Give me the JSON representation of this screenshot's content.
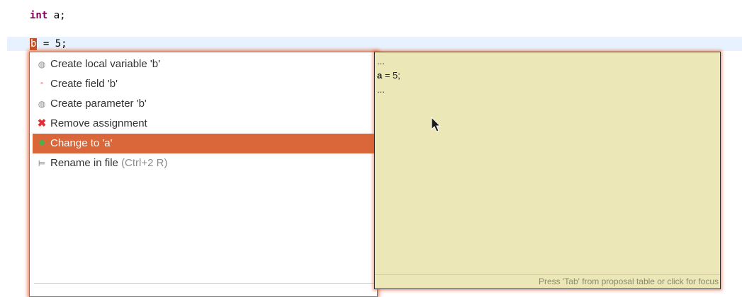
{
  "editor": {
    "line1": {
      "keyword": "int",
      "rest": " a;"
    },
    "line2": {
      "var": "b",
      "rest": " = 5;"
    }
  },
  "proposals": {
    "items": [
      {
        "icon": "local-variable-icon",
        "label": "Create local variable 'b'"
      },
      {
        "icon": "field-icon",
        "label": "Create field 'b'"
      },
      {
        "icon": "parameter-icon",
        "label": "Create parameter 'b'"
      },
      {
        "icon": "remove-icon",
        "label": "Remove assignment"
      },
      {
        "icon": "change-icon",
        "label": "Change to 'a'",
        "selected": true
      },
      {
        "icon": "rename-icon",
        "label": "Rename in file",
        "shortcut": "(Ctrl+2 R)"
      }
    ]
  },
  "preview": {
    "line1": "...",
    "line2_bold": "a",
    "line2_rest": " = 5;",
    "line3": "...",
    "footer": "Press 'Tab' from proposal table or click for focus"
  },
  "colors": {
    "selection": "#d9673a",
    "preview_bg": "#ece7b7",
    "keyword": "#7f0055",
    "current_line": "#e8f2fe"
  }
}
